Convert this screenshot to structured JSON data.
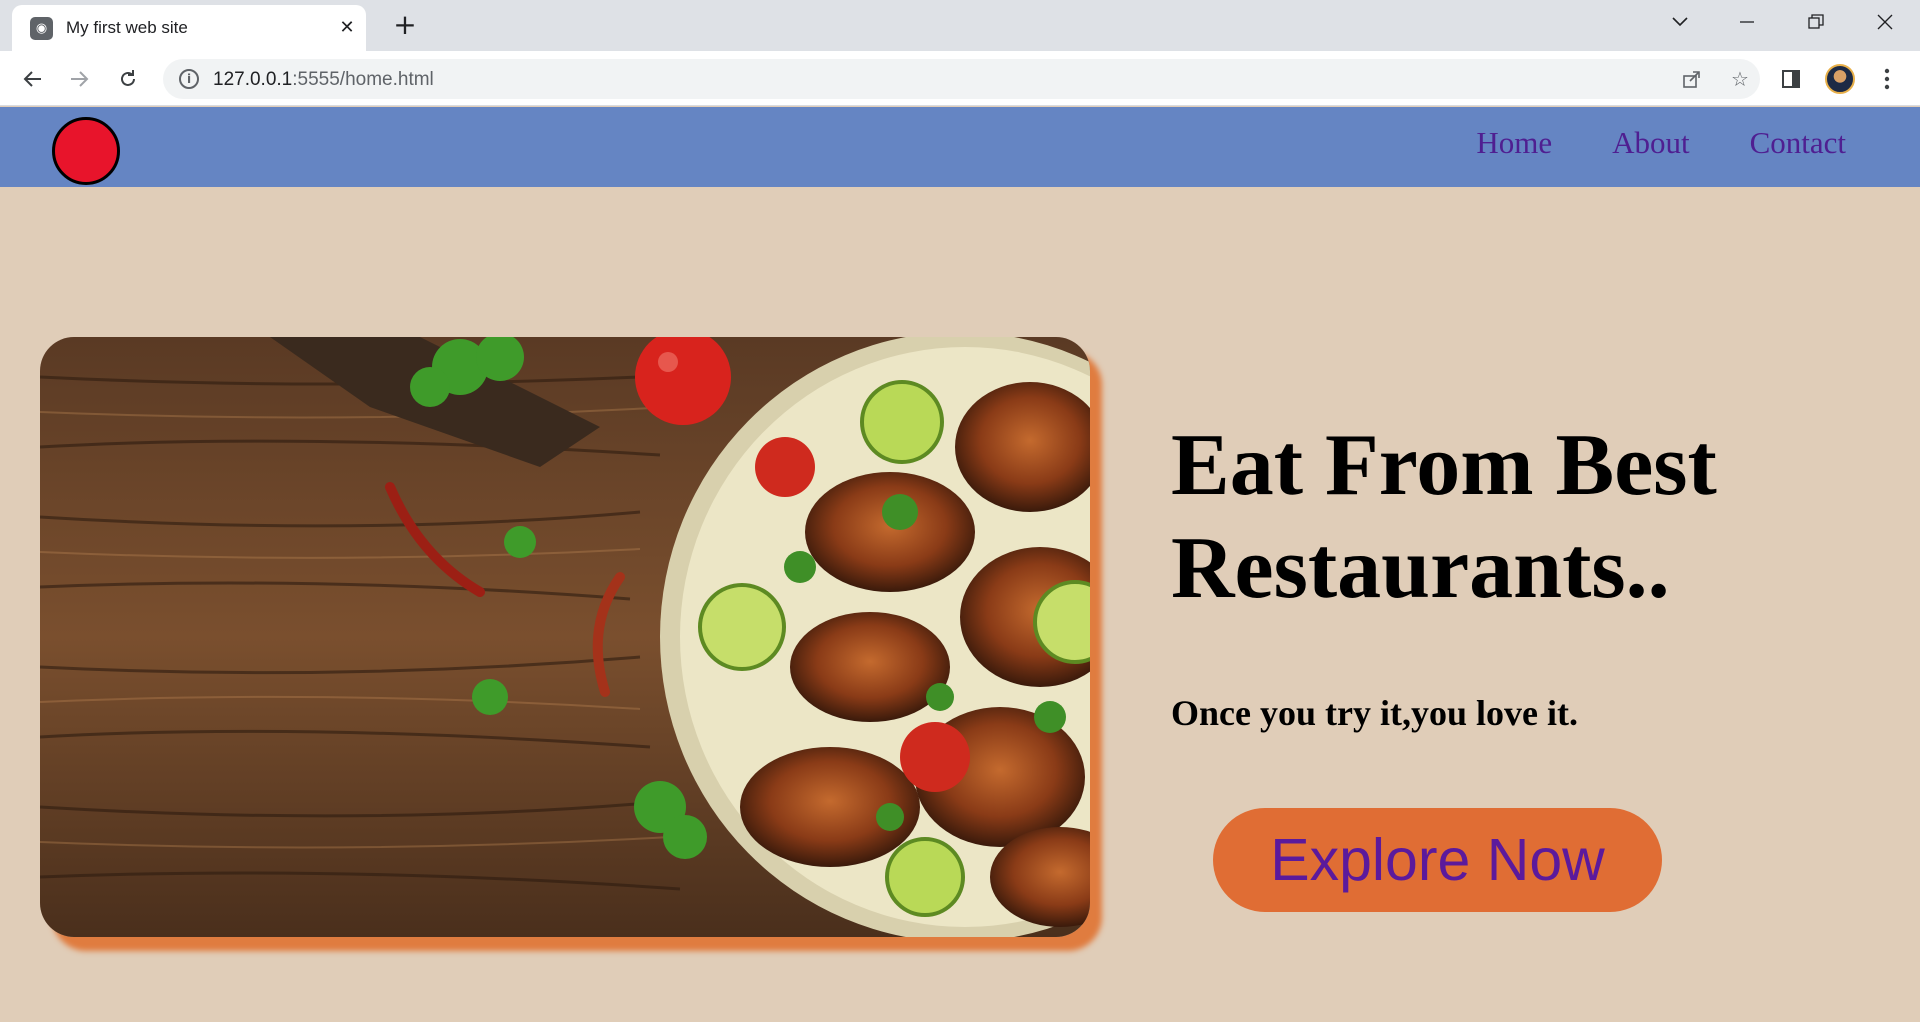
{
  "browser": {
    "tab_title": "My first web site",
    "tab_close": "✕",
    "new_tab": "+",
    "url_host": "127.0.0.1",
    "url_rest": ":5555/home.html",
    "icons": {
      "favicon": "broadcast-icon",
      "back": "arrow-left-icon",
      "forward": "arrow-right-icon",
      "reload": "reload-icon",
      "info": "info-icon",
      "share": "share-icon",
      "bookmark": "star-icon",
      "sidepanel": "side-panel-icon",
      "profile": "avatar",
      "menu": "kebab-menu-icon"
    }
  },
  "site": {
    "header_color": "#6585c3",
    "logo_color": "#e8142b",
    "nav": [
      {
        "label": "Home"
      },
      {
        "label": "About"
      },
      {
        "label": "Contact"
      }
    ],
    "nav_color": "#4f1f91"
  },
  "hero": {
    "title": "Eat From Best Restaurants..",
    "subtitle": "Once you try it,you love it.",
    "button_label": "Explore Now",
    "button_color": "#e06d34",
    "image": "grilled-chicken-wings-plate-photo"
  }
}
